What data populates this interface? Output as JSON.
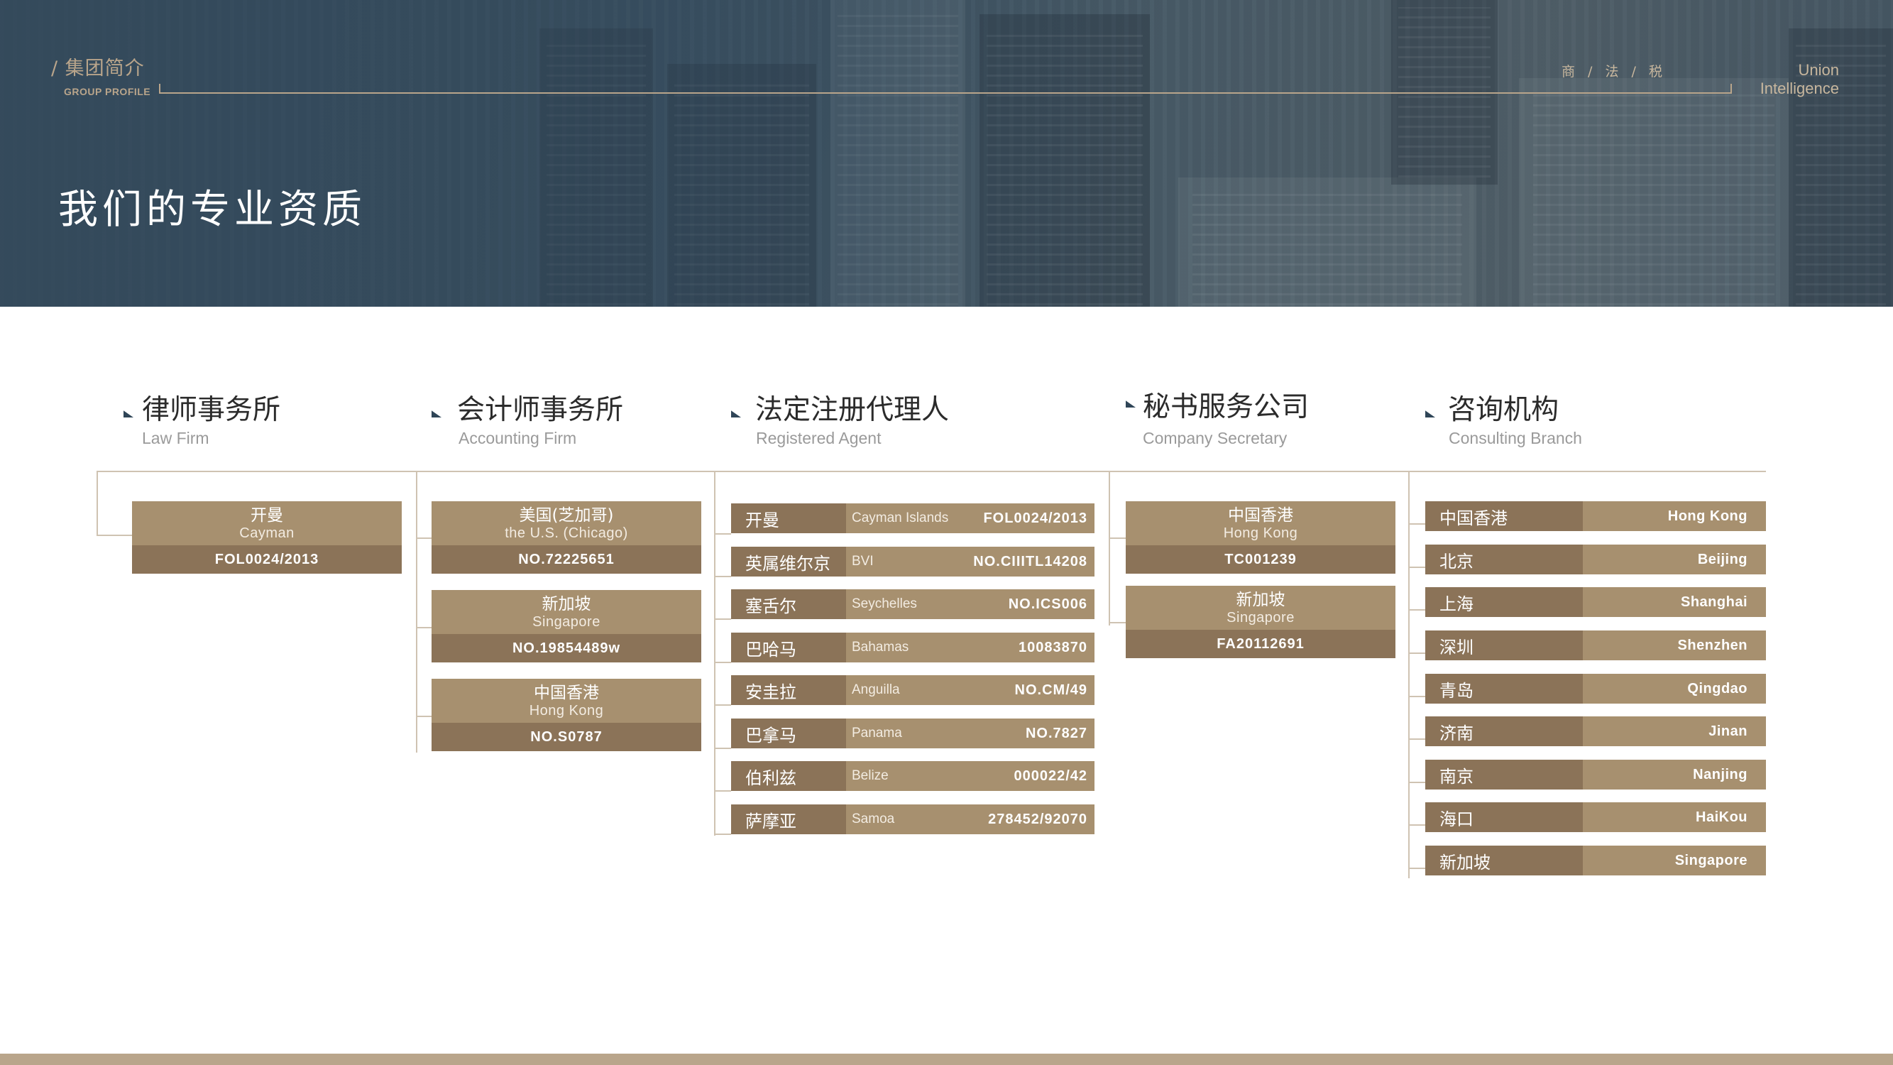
{
  "header": {
    "section_label": "/ 集团简介",
    "section_sub": "GROUP PROFILE",
    "tags": "商 / 法 / 税",
    "brand_line1": "Union",
    "brand_line2": "Intelligence",
    "page_title": "我们的专业资质"
  },
  "colors": {
    "accent_dark": "#8b7358",
    "accent_light": "#a7906f",
    "navy": "#2f4557",
    "line": "#cfc3b2"
  },
  "categories": [
    {
      "title": "律师事务所",
      "subtitle": "Law Firm",
      "cards": [
        {
          "cn": "开曼",
          "en": "Cayman",
          "code": "FOL0024/2013"
        }
      ]
    },
    {
      "title": "会计师事务所",
      "subtitle": "Accounting Firm",
      "cards": [
        {
          "cn": "美国(芝加哥)",
          "en": "the U.S. (Chicago)",
          "code": "NO.72225651"
        },
        {
          "cn": "新加坡",
          "en": "Singapore",
          "code": "NO.19854489w"
        },
        {
          "cn": "中国香港",
          "en": "Hong Kong",
          "code": "NO.S0787"
        }
      ]
    },
    {
      "title": "法定注册代理人",
      "subtitle": "Registered Agent",
      "rows": [
        {
          "cn": "开曼",
          "en": "Cayman Islands",
          "code": "FOL0024/2013"
        },
        {
          "cn": "英属维尔京",
          "en": "BVI",
          "code": "NO.CIIITL14208"
        },
        {
          "cn": "塞舌尔",
          "en": "Seychelles",
          "code": "NO.ICS006"
        },
        {
          "cn": "巴哈马",
          "en": "Bahamas",
          "code": "10083870"
        },
        {
          "cn": "安圭拉",
          "en": "Anguilla",
          "code": "NO.CM/49"
        },
        {
          "cn": "巴拿马",
          "en": "Panama",
          "code": "NO.7827"
        },
        {
          "cn": "伯利兹",
          "en": "Belize",
          "code": "000022/42"
        },
        {
          "cn": "萨摩亚",
          "en": "Samoa",
          "code": "278452/92070"
        }
      ]
    },
    {
      "title": "秘书服务公司",
      "subtitle": "Company Secretary",
      "cards": [
        {
          "cn": "中国香港",
          "en": "Hong Kong",
          "code": "TC001239"
        },
        {
          "cn": "新加坡",
          "en": "Singapore",
          "code": "FA20112691"
        }
      ]
    },
    {
      "title": "咨询机构",
      "subtitle": "Consulting Branch",
      "rows": [
        {
          "cn": "中国香港",
          "en": "Hong Kong"
        },
        {
          "cn": "北京",
          "en": "Beijing"
        },
        {
          "cn": "上海",
          "en": "Shanghai"
        },
        {
          "cn": "深圳",
          "en": "Shenzhen"
        },
        {
          "cn": "青岛",
          "en": "Qingdao"
        },
        {
          "cn": "济南",
          "en": "Jinan"
        },
        {
          "cn": "南京",
          "en": "Nanjing"
        },
        {
          "cn": "海口",
          "en": "HaiKou"
        },
        {
          "cn": "新加坡",
          "en": "Singapore"
        }
      ]
    }
  ]
}
